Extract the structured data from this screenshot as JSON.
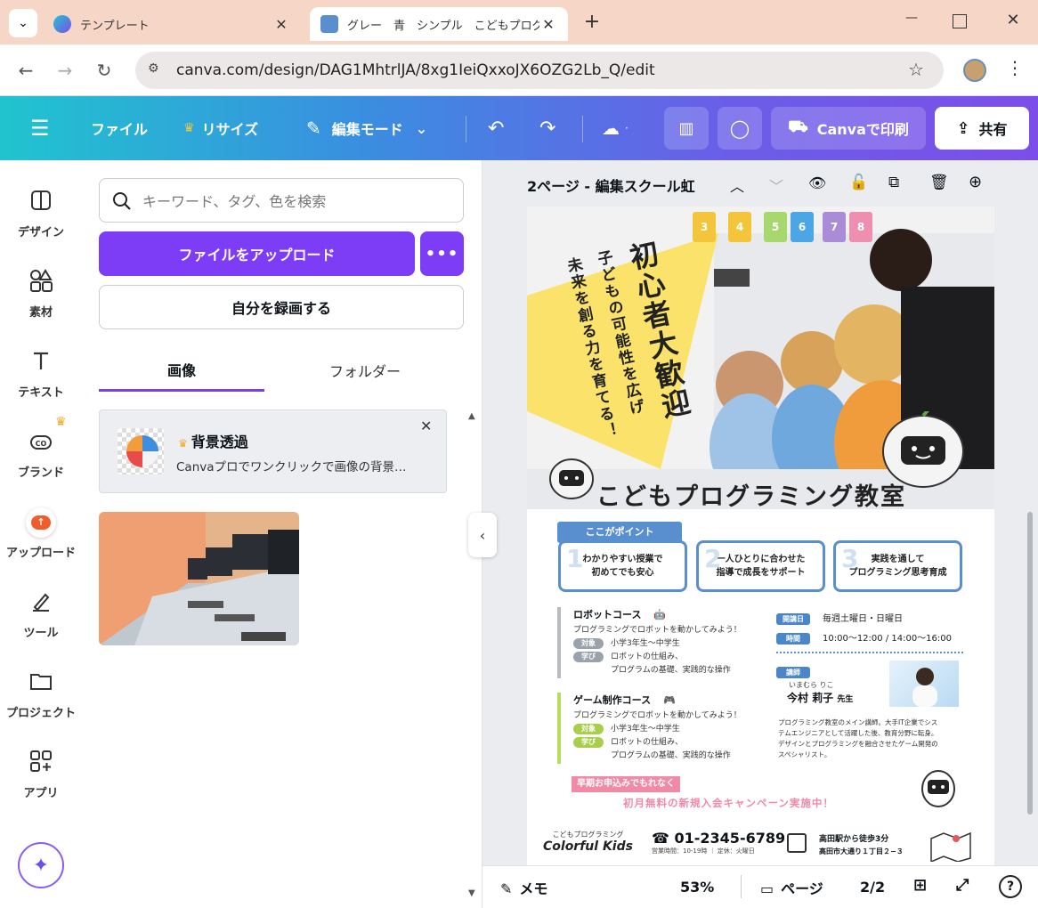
{
  "browser": {
    "tabs": [
      {
        "title": "テンプレート",
        "active": false
      },
      {
        "title": "グレー　青　シンプル　こどもプログラ",
        "active": true
      }
    ],
    "url": "canva.com/design/DAG1MhtrlJA/8xg1IeiQxxoJX6OZG2Lb_Q/edit"
  },
  "toolbar": {
    "file": "ファイル",
    "resize": "リサイズ",
    "edit_mode": "編集モード",
    "print": "Canvaで印刷",
    "share": "共有"
  },
  "rail": {
    "items": [
      {
        "label": "デザイン",
        "icon": "design-icon"
      },
      {
        "label": "素材",
        "icon": "elements-icon"
      },
      {
        "label": "テキスト",
        "icon": "text-icon"
      },
      {
        "label": "ブランド",
        "icon": "brand-icon"
      },
      {
        "label": "アップロード",
        "icon": "upload-icon"
      },
      {
        "label": "ツール",
        "icon": "tools-icon"
      },
      {
        "label": "プロジェクト",
        "icon": "projects-icon"
      },
      {
        "label": "アプリ",
        "icon": "apps-icon"
      }
    ]
  },
  "panel": {
    "search_placeholder": "キーワード、タグ、色を検索",
    "upload_label": "ファイルをアップロード",
    "more_label": "•••",
    "record_label": "自分を録画する",
    "tabs": [
      "画像",
      "フォルダー"
    ],
    "promo": {
      "title": "背景透過",
      "desc": "Canvaプロでワンクリックで画像の背景…"
    }
  },
  "editor": {
    "page_title": "2ページ - 編集スクール虹",
    "zoom": "53%",
    "notes": "メモ",
    "pages_label": "ページ",
    "page_count": "2/2"
  },
  "poster": {
    "chips": [
      {
        "label": "3",
        "color": "#f3c53a"
      },
      {
        "label": "4",
        "color": "#f3c53a"
      },
      {
        "label": "5",
        "color": "#a7d86d"
      },
      {
        "label": "6",
        "color": "#4aa6e5"
      },
      {
        "label": "7",
        "color": "#a98bd6"
      },
      {
        "label": "8",
        "color": "#ee8fb0"
      }
    ],
    "headline_main": "初心者大歓迎",
    "headline_sub1": "子どもの可能性を広げ",
    "headline_sub2": "未来を創る力を育てる！",
    "title": "こどもプログラミング教室",
    "point_label": "ここがポイント",
    "points": [
      {
        "num": "1",
        "text1": "わかりやすい授業で",
        "text2": "初めてでも安心"
      },
      {
        "num": "2",
        "text1": "一人ひとりに合わせた",
        "text2": "指導で成長をサポート"
      },
      {
        "num": "3",
        "text1": "実践を通して",
        "text2": "プログラミング思考育成"
      }
    ],
    "robot_course": {
      "title": "ロボットコース",
      "desc": "プログラミングでロボットを動かしてみよう！",
      "target_label": "対象",
      "target": "小学3年生〜中学生",
      "learn_label": "学び",
      "learn1": "ロボットの仕組み、",
      "learn2": "プログラムの基礎、実践的な操作"
    },
    "game_course": {
      "title": "ゲーム制作コース",
      "desc": "プログラミングでロボットを動かしてみよう！",
      "target_label": "対象",
      "target": "小学3年生〜中学生",
      "learn_label": "学び",
      "learn1": "ロボットの仕組み、",
      "learn2": "プログラムの基礎、実践的な操作"
    },
    "schedule": {
      "day_label": "開講日",
      "days": "毎週土曜日・日曜日",
      "time_label": "時間",
      "times": "10:00〜12:00 / 14:00〜16:00"
    },
    "teacher": {
      "label": "講師",
      "reading": "いまむら りこ",
      "name": "今村 莉子",
      "suffix": "先生",
      "bio1": "プログラミング教室のメイン講師。大手IT企業でシス",
      "bio2": "テムエンジニアとして活躍した後、教育分野に転身。",
      "bio3": "デザインとプログラミングを融合させたゲーム開発の",
      "bio4": "スペシャリスト。"
    },
    "campaign1": "早期お申込みでもれなく",
    "campaign2": "初月無料の新規入会キャンペーン実施中！",
    "footer": {
      "brand_small": "こどもプログラミング",
      "brand": "Colorful Kids",
      "phone": "☎ 01-2345-6789",
      "hours": "営業時間：10-19時 ｜ 定休：火曜日",
      "access1": "高田駅から徒歩3分",
      "access2": "高田市大通り１丁目２−３"
    }
  }
}
